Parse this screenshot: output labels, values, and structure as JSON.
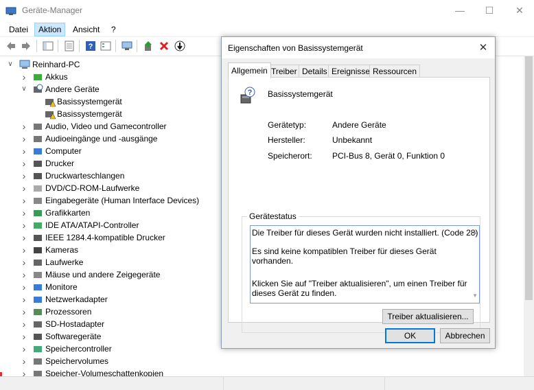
{
  "window": {
    "title": "Geräte-Manager"
  },
  "menu": [
    "Datei",
    "Aktion",
    "Ansicht",
    "?"
  ],
  "tree": {
    "root": "Reinhard-PC",
    "items": [
      {
        "label": "Akkus",
        "icon": "battery-icon",
        "expanded": false
      },
      {
        "label": "Andere Geräte",
        "icon": "unknown-device-icon",
        "expanded": true
      },
      {
        "label": "Basissystemgerät",
        "icon": "warning-device-icon",
        "child": true
      },
      {
        "label": "Basissystemgerät",
        "icon": "warning-device-icon",
        "child": true
      },
      {
        "label": "Audio, Video und Gamecontroller",
        "icon": "speaker-icon",
        "expanded": false
      },
      {
        "label": "Audioeingänge und -ausgänge",
        "icon": "speaker-icon",
        "expanded": false
      },
      {
        "label": "Computer",
        "icon": "computer-icon",
        "expanded": false
      },
      {
        "label": "Drucker",
        "icon": "printer-icon",
        "expanded": false
      },
      {
        "label": "Druckwarteschlangen",
        "icon": "printer-icon",
        "expanded": false
      },
      {
        "label": "DVD/CD-ROM-Laufwerke",
        "icon": "disc-icon",
        "expanded": false
      },
      {
        "label": "Eingabegeräte (Human Interface Devices)",
        "icon": "hid-icon",
        "expanded": false
      },
      {
        "label": "Grafikkarten",
        "icon": "display-adapter-icon",
        "expanded": false
      },
      {
        "label": "IDE ATA/ATAPI-Controller",
        "icon": "controller-icon",
        "expanded": false
      },
      {
        "label": "IEEE 1284.4-kompatible Drucker",
        "icon": "printer-icon",
        "expanded": false
      },
      {
        "label": "Kameras",
        "icon": "camera-icon",
        "expanded": false
      },
      {
        "label": "Laufwerke",
        "icon": "drive-icon",
        "expanded": false
      },
      {
        "label": "Mäuse und andere Zeigegeräte",
        "icon": "mouse-icon",
        "expanded": false
      },
      {
        "label": "Monitore",
        "icon": "monitor-icon",
        "expanded": false
      },
      {
        "label": "Netzwerkadapter",
        "icon": "network-icon",
        "expanded": false
      },
      {
        "label": "Prozessoren",
        "icon": "processor-icon",
        "expanded": false
      },
      {
        "label": "SD-Hostadapter",
        "icon": "sd-icon",
        "expanded": false
      },
      {
        "label": "Softwaregeräte",
        "icon": "software-device-icon",
        "expanded": false
      },
      {
        "label": "Speichercontroller",
        "icon": "storage-controller-icon",
        "expanded": false
      },
      {
        "label": "Speichervolumes",
        "icon": "volume-icon",
        "expanded": false
      },
      {
        "label": "Speicher-Volumeschattenkopien",
        "icon": "volume-icon",
        "expanded": false
      }
    ]
  },
  "dialog": {
    "title": "Eigenschaften von Basissystemgerät",
    "tabs": [
      "Allgemein",
      "Treiber",
      "Details",
      "Ereignisse",
      "Ressourcen"
    ],
    "device_name": "Basissystemgerät",
    "fields": [
      {
        "key": "Gerätetyp:",
        "value": "Andere Geräte"
      },
      {
        "key": "Hersteller:",
        "value": "Unbekannt"
      },
      {
        "key": "Speicherort:",
        "value": "PCI-Bus 8, Gerät 0, Funktion 0"
      }
    ],
    "status_label": "Gerätestatus",
    "status_lines": [
      "Die Treiber für dieses Gerät wurden nicht installiert. (Code 28)",
      "Es sind keine kompatiblen Treiber für dieses Gerät vorhanden.",
      "Klicken Sie auf \"Treiber aktualisieren\", um einen Treiber für dieses Gerät zu finden."
    ],
    "update_button": "Treiber aktualisieren...",
    "ok_button": "OK",
    "cancel_button": "Abbrechen"
  },
  "colors": {
    "accent": "#0078d7",
    "selection": "#cce8ff",
    "warning": "#f5c211",
    "error": "#e02020"
  }
}
